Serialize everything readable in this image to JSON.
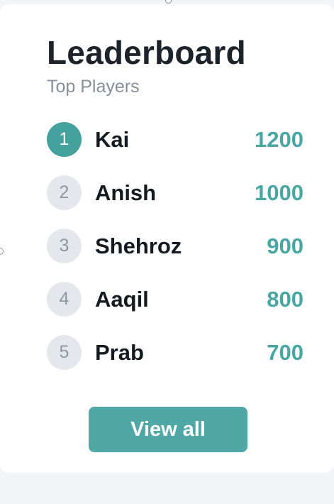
{
  "leaderboard": {
    "title": "Leaderboard",
    "subtitle": "Top Players",
    "players": [
      {
        "rank": "1",
        "name": "Kai",
        "score": "1200"
      },
      {
        "rank": "2",
        "name": "Anish",
        "score": "1000"
      },
      {
        "rank": "3",
        "name": "Shehroz",
        "score": "900"
      },
      {
        "rank": "4",
        "name": "Aaqil",
        "score": "800"
      },
      {
        "rank": "5",
        "name": "Prab",
        "score": "700"
      }
    ],
    "button_label": "View all"
  },
  "colors": {
    "page_background": "#f3f4f7",
    "card_background": "#ffffff",
    "accent": "#45a19d",
    "score_text": "#48a7a3",
    "rank_inactive": "#e4e7eb",
    "title_text": "#1d232b",
    "subtitle_text": "#86909c"
  }
}
